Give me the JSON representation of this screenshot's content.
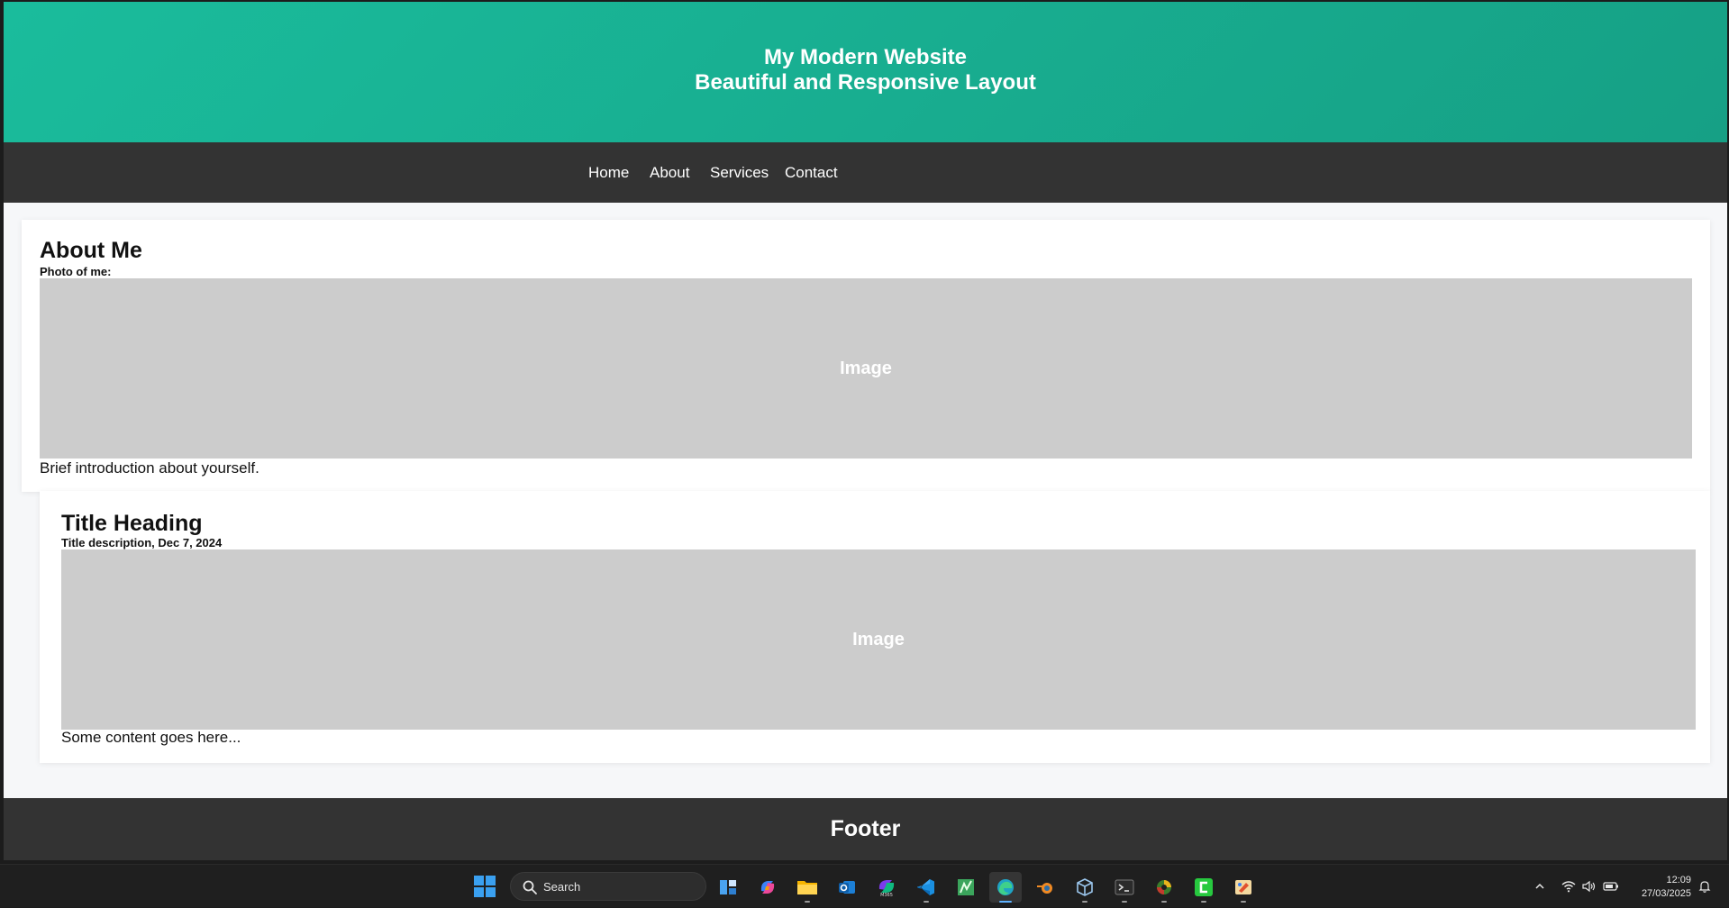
{
  "header": {
    "title": "My Modern Website",
    "subtitle": "Beautiful and Responsive Layout"
  },
  "nav": {
    "items": [
      {
        "label": "Home"
      },
      {
        "label": "About"
      },
      {
        "label": "Services"
      },
      {
        "label": "Contact"
      }
    ]
  },
  "about_card": {
    "heading": "About Me",
    "subheading": "Photo of me:",
    "image_label": "Image",
    "text": "Brief introduction about yourself."
  },
  "post_card": {
    "heading": "Title Heading",
    "subheading": "Title description, Dec 7, 2024",
    "image_label": "Image",
    "text": "Some content goes here..."
  },
  "footer": {
    "text": "Footer"
  },
  "taskbar": {
    "search_label": "Search",
    "apps": [
      {
        "name": "widgets-icon"
      },
      {
        "name": "copilot-icon"
      },
      {
        "name": "file-explorer-icon"
      },
      {
        "name": "outlook-icon"
      },
      {
        "name": "m365-copilot-icon"
      },
      {
        "name": "vscode-icon"
      },
      {
        "name": "spreadsheet-app-icon"
      },
      {
        "name": "edge-browser-icon"
      },
      {
        "name": "blender-icon"
      },
      {
        "name": "virtualbox-icon"
      },
      {
        "name": "terminal-icon"
      },
      {
        "name": "colorful-app-icon"
      },
      {
        "name": "green-c-app-icon"
      },
      {
        "name": "paint-app-icon"
      }
    ],
    "clock": {
      "time": "12:09",
      "date": "27/03/2025"
    }
  },
  "colors": {
    "header_gradient_start": "#1abc9c",
    "header_gradient_end": "#16a085",
    "nav_bg": "#333333",
    "placeholder_bg": "#cccccc",
    "taskbar_bg": "#1f1f1f"
  }
}
